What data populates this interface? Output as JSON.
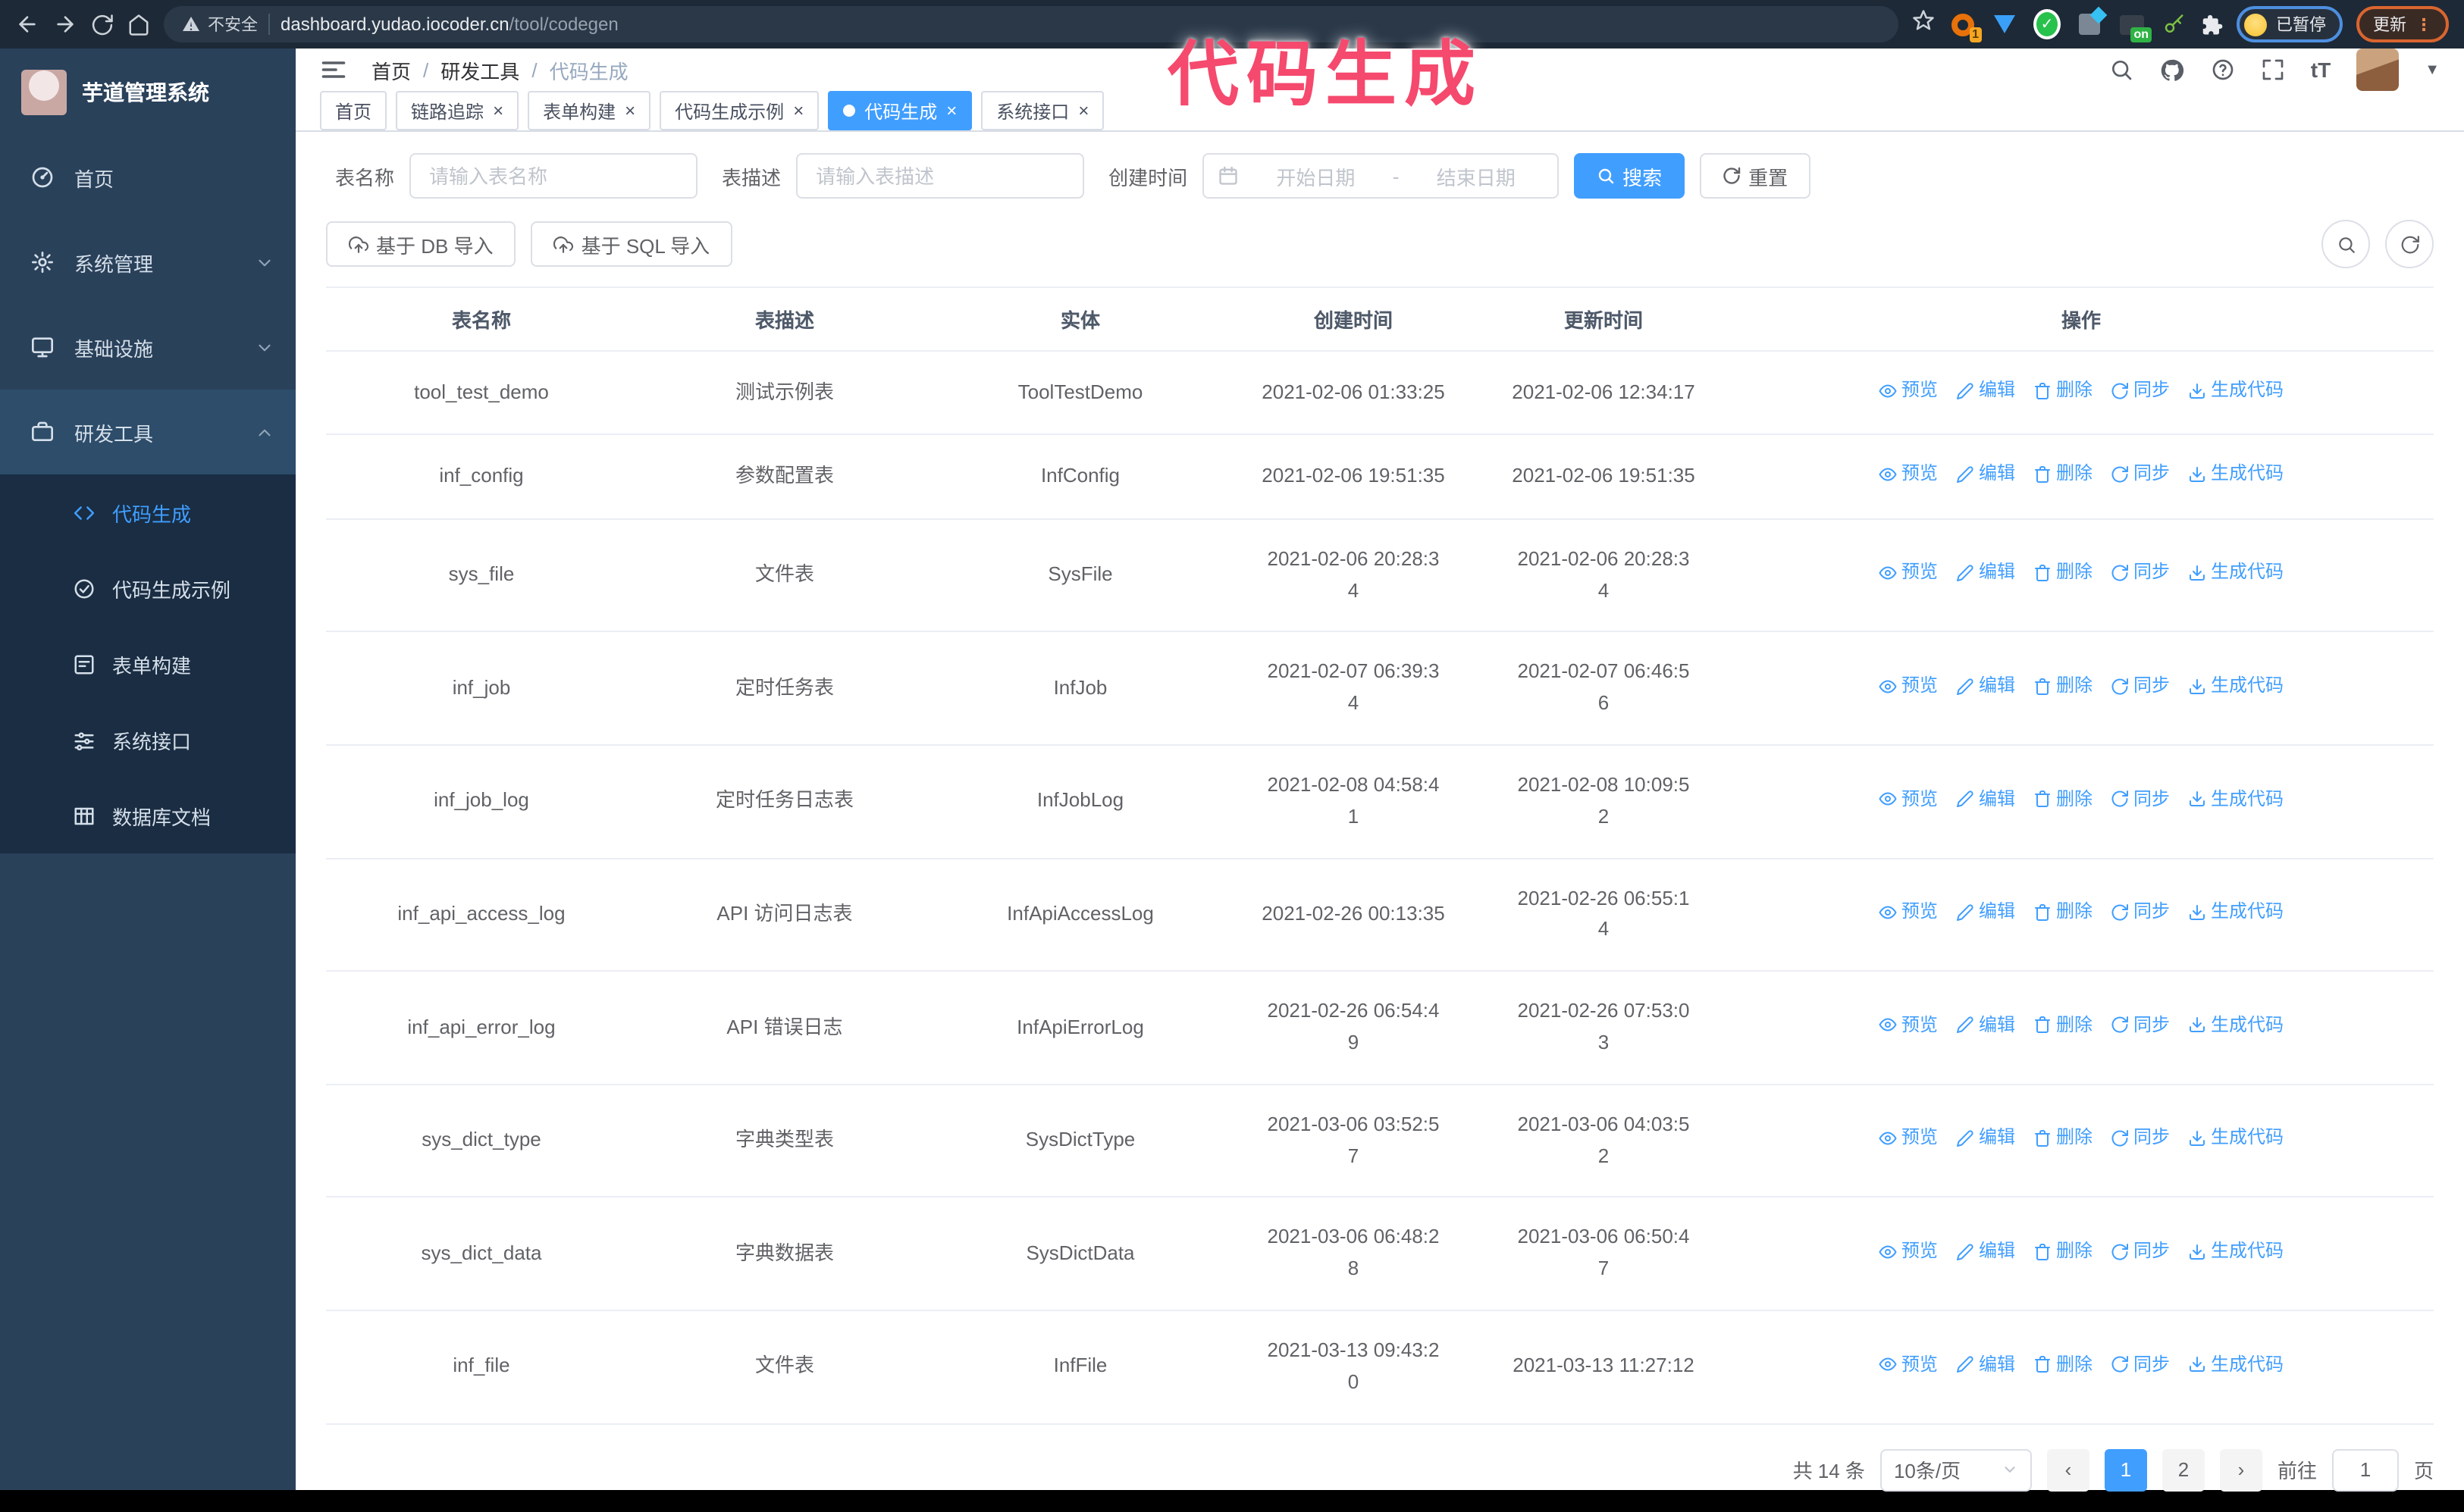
{
  "browser": {
    "security_label": "不安全",
    "url_domain": "dashboard.yudao.iocoder.cn",
    "url_path": "/tool/codegen",
    "extension_badge": "1",
    "extension_on_badge": "on",
    "paused_badge": "已暂停",
    "update_button": "更新"
  },
  "overlay": {
    "text": "代码生成",
    "color": "#f5496d"
  },
  "sidebar": {
    "logo_title": "芋道管理系统",
    "items": [
      {
        "key": "home",
        "label": "首页",
        "icon": "dashboard"
      },
      {
        "key": "system",
        "label": "系统管理",
        "icon": "gear",
        "chevron": "down"
      },
      {
        "key": "infra",
        "label": "基础设施",
        "icon": "monitor",
        "chevron": "down"
      },
      {
        "key": "dev-tools",
        "label": "研发工具",
        "icon": "briefcase",
        "chevron": "up",
        "open": true
      }
    ],
    "submenu": [
      {
        "key": "codegen",
        "label": "代码生成",
        "icon": "code",
        "active": true
      },
      {
        "key": "codegen-example",
        "label": "代码生成示例",
        "icon": "check-circle"
      },
      {
        "key": "form-builder",
        "label": "表单构建",
        "icon": "form"
      },
      {
        "key": "system-api",
        "label": "系统接口",
        "icon": "sliders"
      },
      {
        "key": "db-doc",
        "label": "数据库文档",
        "icon": "table"
      }
    ]
  },
  "header": {
    "breadcrumb": [
      "首页",
      "研发工具",
      "代码生成"
    ]
  },
  "tabs": [
    {
      "key": "home",
      "label": "首页",
      "closable": false,
      "active": false
    },
    {
      "key": "tracing",
      "label": "链路追踪",
      "closable": true,
      "active": false
    },
    {
      "key": "form-builder",
      "label": "表单构建",
      "closable": true,
      "active": false
    },
    {
      "key": "codegen-example",
      "label": "代码生成示例",
      "closable": true,
      "active": false
    },
    {
      "key": "codegen",
      "label": "代码生成",
      "closable": true,
      "active": true
    },
    {
      "key": "system-api",
      "label": "系统接口",
      "closable": true,
      "active": false
    }
  ],
  "search": {
    "name_label": "表名称",
    "name_placeholder": "请输入表名称",
    "desc_label": "表描述",
    "desc_placeholder": "请输入表描述",
    "time_label": "创建时间",
    "start_placeholder": "开始日期",
    "range_separator": "-",
    "end_placeholder": "结束日期",
    "search_button": "搜索",
    "reset_button": "重置"
  },
  "toolbar": {
    "import_db_button": "基于 DB 导入",
    "import_sql_button": "基于 SQL 导入"
  },
  "table": {
    "columns": [
      "表名称",
      "表描述",
      "实体",
      "创建时间",
      "更新时间",
      "操作"
    ],
    "action_labels": [
      "预览",
      "编辑",
      "删除",
      "同步",
      "生成代码"
    ],
    "rows": [
      {
        "name": "tool_test_demo",
        "desc": "测试示例表",
        "entity": "ToolTestDemo",
        "created": "2021-02-06 01:33:25",
        "updated": "2021-02-06 12:34:17"
      },
      {
        "name": "inf_config",
        "desc": "参数配置表",
        "entity": "InfConfig",
        "created": "2021-02-06 19:51:35",
        "updated": "2021-02-06 19:51:35"
      },
      {
        "name": "sys_file",
        "desc": "文件表",
        "entity": "SysFile",
        "created": "2021-02-06 20:28:3\n4",
        "updated": "2021-02-06 20:28:3\n4"
      },
      {
        "name": "inf_job",
        "desc": "定时任务表",
        "entity": "InfJob",
        "created": "2021-02-07 06:39:3\n4",
        "updated": "2021-02-07 06:46:5\n6"
      },
      {
        "name": "inf_job_log",
        "desc": "定时任务日志表",
        "entity": "InfJobLog",
        "created": "2021-02-08 04:58:4\n1",
        "updated": "2021-02-08 10:09:5\n2"
      },
      {
        "name": "inf_api_access_log",
        "desc": "API 访问日志表",
        "entity": "InfApiAccessLog",
        "created": "2021-02-26 00:13:35",
        "updated": "2021-02-26 06:55:1\n4"
      },
      {
        "name": "inf_api_error_log",
        "desc": "API 错误日志",
        "entity": "InfApiErrorLog",
        "created": "2021-02-26 06:54:4\n9",
        "updated": "2021-02-26 07:53:0\n3"
      },
      {
        "name": "sys_dict_type",
        "desc": "字典类型表",
        "entity": "SysDictType",
        "created": "2021-03-06 03:52:5\n7",
        "updated": "2021-03-06 04:03:5\n2"
      },
      {
        "name": "sys_dict_data",
        "desc": "字典数据表",
        "entity": "SysDictData",
        "created": "2021-03-06 06:48:2\n8",
        "updated": "2021-03-06 06:50:4\n7"
      },
      {
        "name": "inf_file",
        "desc": "文件表",
        "entity": "InfFile",
        "created": "2021-03-13 09:43:2\n0",
        "updated": "2021-03-13 11:27:12"
      }
    ]
  },
  "pagination": {
    "total": "共 14 条",
    "page_size": "10条/页",
    "pages": [
      "1",
      "2"
    ],
    "active_page": "1",
    "goto_label": "前往",
    "goto_value": "1",
    "page_label": "页"
  },
  "colors": {
    "primary": "#409eff",
    "sidebar_bg": "#2a415a",
    "sidebar_submenu_bg": "#1a2d43",
    "sidebar_open_bg": "#2d4d6a",
    "chrome_bg": "#1d2936",
    "overlay_pink": "#f5496d",
    "update_border_orange": "#d9652f",
    "paused_border_blue": "#4d8fe0"
  }
}
